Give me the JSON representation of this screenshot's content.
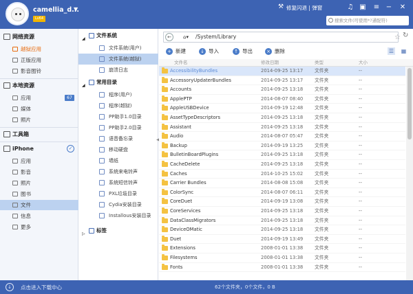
{
  "titlebar": {
    "username": "camellia_d...",
    "vip_badge": "Lv64",
    "fix_crash": "修复闪退 | 弹窗",
    "search_placeholder": "搜索文件(可使用*?通配符)"
  },
  "sidebar": {
    "network_title": "网络资源",
    "network_items": [
      "越狱应用",
      "正版应用",
      "影音图铃"
    ],
    "local_title": "本地资源",
    "local_items": [
      "应用",
      "媒体",
      "照片"
    ],
    "local_badge": "67",
    "toolbox_title": "工具箱",
    "device_title": "iPhone",
    "device_items": [
      "应用",
      "影音",
      "照片",
      "图书",
      "文件",
      "信息",
      "更多"
    ]
  },
  "tree": {
    "fs_title": "文件系统",
    "fs_items": [
      "文件系统(用户)",
      "文件系统(越狱)",
      "崩溃日志"
    ],
    "common_title": "常用目录",
    "common_items": [
      "程序(用户)",
      "程序(越狱)",
      "PP助手1.0目录",
      "PP助手2.0目录",
      "语音备忘录",
      "移动硬盘",
      "墙纸",
      "系统来电铃声",
      "系统短信铃声",
      "PXL垃圾目录",
      "Cydia安装目录",
      "Installous安装目录"
    ],
    "tags_title": "标签"
  },
  "main": {
    "path": "/System/Library",
    "toolbar": {
      "new": "新建",
      "import": "导入",
      "export": "导出",
      "delete": "删除"
    },
    "columns": {
      "name": "文件名",
      "date": "修改日期",
      "type": "类型",
      "size": "大小"
    },
    "rows": [
      {
        "name": "AccessibilityBundles",
        "date": "2014-09-25 13:17",
        "type": "文件夹",
        "size": "--"
      },
      {
        "name": "AccessoryUpdaterBundles",
        "date": "2014-09-25 13:17",
        "type": "文件夹",
        "size": "--"
      },
      {
        "name": "Accounts",
        "date": "2014-09-25 13:18",
        "type": "文件夹",
        "size": "--"
      },
      {
        "name": "ApplePTP",
        "date": "2014-08-07 08:40",
        "type": "文件夹",
        "size": "--"
      },
      {
        "name": "AppleUSBDevice",
        "date": "2014-09-19 12:48",
        "type": "文件夹",
        "size": "--"
      },
      {
        "name": "AssetTypeDescriptors",
        "date": "2014-09-25 13:18",
        "type": "文件夹",
        "size": "--"
      },
      {
        "name": "Assistant",
        "date": "2014-09-25 13:18",
        "type": "文件夹",
        "size": "--"
      },
      {
        "name": "Audio",
        "date": "2014-08-07 05:47",
        "type": "文件夹",
        "size": "--"
      },
      {
        "name": "Backup",
        "date": "2014-09-19 13:25",
        "type": "文件夹",
        "size": "--"
      },
      {
        "name": "BulletinBoardPlugins",
        "date": "2014-09-25 13:18",
        "type": "文件夹",
        "size": "--"
      },
      {
        "name": "CacheDelete",
        "date": "2014-09-25 13:18",
        "type": "文件夹",
        "size": "--"
      },
      {
        "name": "Caches",
        "date": "2014-10-25 15:02",
        "type": "文件夹",
        "size": "--"
      },
      {
        "name": "Carrier Bundles",
        "date": "2014-08-08 15:08",
        "type": "文件夹",
        "size": "--"
      },
      {
        "name": "ColorSync",
        "date": "2014-08-07 06:11",
        "type": "文件夹",
        "size": "--"
      },
      {
        "name": "CoreDuet",
        "date": "2014-09-19 13:08",
        "type": "文件夹",
        "size": "--"
      },
      {
        "name": "CoreServices",
        "date": "2014-09-25 13:18",
        "type": "文件夹",
        "size": "--"
      },
      {
        "name": "DataClassMigrators",
        "date": "2014-09-25 13:18",
        "type": "文件夹",
        "size": "--"
      },
      {
        "name": "DeviceOMatic",
        "date": "2014-09-25 13:18",
        "type": "文件夹",
        "size": "--"
      },
      {
        "name": "Duet",
        "date": "2014-09-19 13:49",
        "type": "文件夹",
        "size": "--"
      },
      {
        "name": "Extensions",
        "date": "2008-01-01 13:38",
        "type": "文件夹",
        "size": "--"
      },
      {
        "name": "Filesystems",
        "date": "2008-01-01 13:38",
        "type": "文件夹",
        "size": "--"
      },
      {
        "name": "Fonts",
        "date": "2008-01-01 13:38",
        "type": "文件夹",
        "size": "--"
      }
    ]
  },
  "status": {
    "download_center": "点击进入下载中心",
    "summary": "62个文件夹，0个文件，0 B"
  }
}
